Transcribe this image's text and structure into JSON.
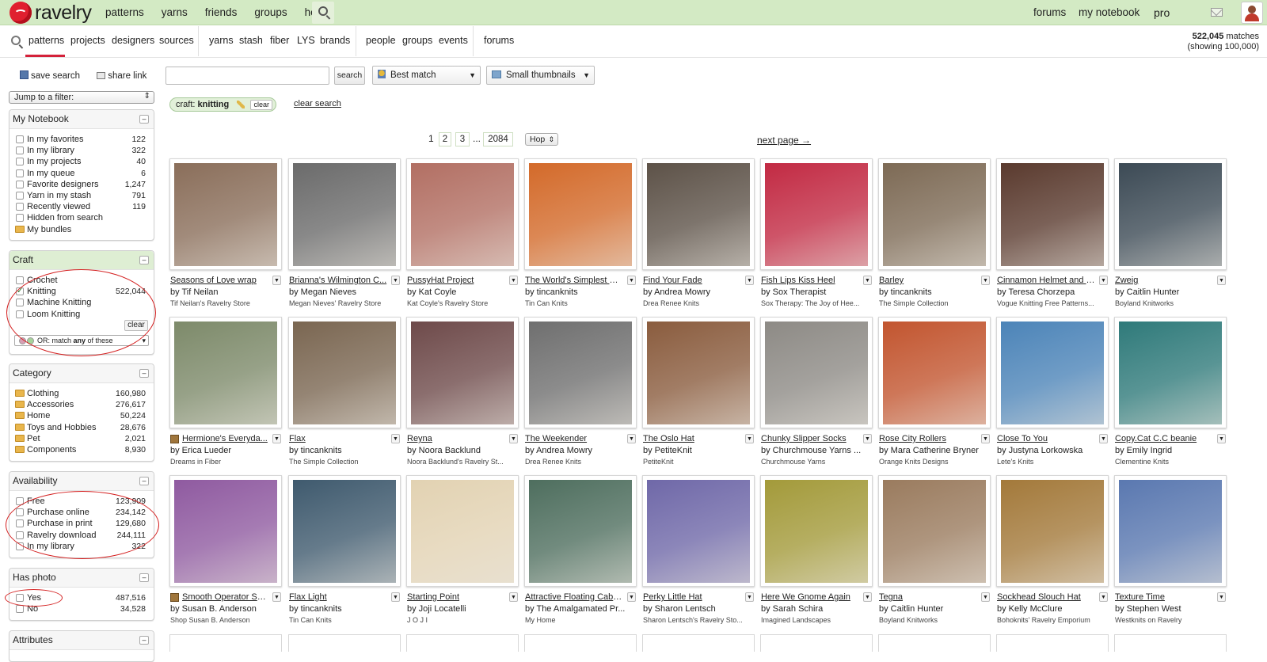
{
  "topbar": {
    "brand": "ravelry",
    "nav": [
      "patterns",
      "yarns",
      "friends",
      "groups",
      "help"
    ],
    "right": {
      "forums": "forums",
      "notebook": "my notebook",
      "pro": "pro"
    }
  },
  "subnav": {
    "group1": [
      "patterns",
      "projects",
      "designers",
      "sources"
    ],
    "group2": [
      "yarns",
      "stash",
      "fiber",
      "LYS",
      "brands"
    ],
    "group3": [
      "people",
      "groups",
      "events"
    ],
    "group4": [
      "forums"
    ],
    "matches_count": "522,045",
    "matches_label": "matches",
    "showing": "(showing 100,000)"
  },
  "sidebar": {
    "save_search": "save search",
    "share_link": "share link",
    "jump": "Jump to a filter:",
    "notebook": {
      "title": "My Notebook",
      "items": [
        {
          "label": "In my favorites",
          "count": "122"
        },
        {
          "label": "In my library",
          "count": "322"
        },
        {
          "label": "In my projects",
          "count": "40"
        },
        {
          "label": "In my queue",
          "count": "6"
        },
        {
          "label": "Favorite designers",
          "count": "1,247"
        },
        {
          "label": "Yarn in my stash",
          "count": "791"
        },
        {
          "label": "Recently viewed",
          "count": "119"
        },
        {
          "label": "Hidden from search",
          "count": ""
        },
        {
          "label": "My bundles",
          "count": ""
        }
      ]
    },
    "craft": {
      "title": "Craft",
      "items": [
        {
          "label": "Crochet",
          "count": "",
          "checked": false
        },
        {
          "label": "Knitting",
          "count": "522,044",
          "checked": true
        },
        {
          "label": "Machine Knitting",
          "count": "",
          "checked": false
        },
        {
          "label": "Loom Knitting",
          "count": "",
          "checked": false
        }
      ],
      "clear": "clear",
      "or_prefix": "OR: match ",
      "or_bold": "any",
      "or_suffix": " of these"
    },
    "category": {
      "title": "Category",
      "items": [
        {
          "label": "Clothing",
          "count": "160,980"
        },
        {
          "label": "Accessories",
          "count": "276,617"
        },
        {
          "label": "Home",
          "count": "50,224"
        },
        {
          "label": "Toys and Hobbies",
          "count": "28,676"
        },
        {
          "label": "Pet",
          "count": "2,021"
        },
        {
          "label": "Components",
          "count": "8,930"
        }
      ]
    },
    "availability": {
      "title": "Availability",
      "items": [
        {
          "label": "Free",
          "count": "123,909"
        },
        {
          "label": "Purchase online",
          "count": "234,142"
        },
        {
          "label": "Purchase in print",
          "count": "129,680"
        },
        {
          "label": "Ravelry download",
          "count": "244,111"
        },
        {
          "label": "In my library",
          "count": "322"
        }
      ]
    },
    "photo": {
      "title": "Has photo",
      "items": [
        {
          "label": "Yes",
          "count": "487,516"
        },
        {
          "label": "No",
          "count": "34,528"
        }
      ]
    },
    "attributes": {
      "title": "Attributes"
    }
  },
  "search": {
    "value": "",
    "button": "search",
    "sort": "Best match",
    "view": "Small thumbnails",
    "chip_key": "craft:",
    "chip_value": "knitting",
    "chip_clear": "clear",
    "clear_search": "clear search"
  },
  "pagination": {
    "current": "1",
    "pages": [
      "2",
      "3"
    ],
    "ellipsis": "...",
    "last": "2084",
    "hop": "Hop",
    "next": "next page →"
  },
  "patterns": [
    {
      "title": "Seasons of Love wrap",
      "by": "by Tif Neilan",
      "source": "Tif Neilan's Ravelry Store",
      "library": false,
      "color": "#8a6e5a"
    },
    {
      "title": "Brianna's Wilmington C...",
      "by": "by Megan Nieves",
      "source": "Megan Nieves' Ravelry Store",
      "library": false,
      "color": "#6b6b6b"
    },
    {
      "title": "PussyHat Project",
      "by": "by Kat Coyle",
      "source": "Kat Coyle's Ravelry Store",
      "library": false,
      "color": "#b26f63"
    },
    {
      "title": "The World's Simplest Mi...",
      "by": "by tincanknits",
      "source": "Tin Can Knits",
      "library": false,
      "color": "#d36a2a"
    },
    {
      "title": "Find Your Fade",
      "by": "by Andrea Mowry",
      "source": "Drea Renee Knits",
      "library": false,
      "color": "#5d5248"
    },
    {
      "title": "Fish Lips Kiss Heel",
      "by": "by Sox Therapist",
      "source": "Sox Therapy: The Joy of Hee...",
      "library": false,
      "color": "#c22a43"
    },
    {
      "title": "Barley",
      "by": "by tincanknits",
      "source": "The Simple Collection",
      "library": false,
      "color": "#7d6a55"
    },
    {
      "title": "Cinnamon Helmet and S...",
      "by": "by Teresa Chorzepa",
      "source": "Vogue Knitting Free Patterns...",
      "library": false,
      "color": "#5a3a2e"
    },
    {
      "title": "Zweig",
      "by": "by Caitlin Hunter",
      "source": "Boyland Knitworks",
      "library": false,
      "color": "#3c4a55"
    },
    {
      "title": "Hermione's Everyda...",
      "by": "by Erica Lueder",
      "source": "Dreams in Fiber",
      "library": true,
      "color": "#7d8a6a"
    },
    {
      "title": "Flax",
      "by": "by tincanknits",
      "source": "The Simple Collection",
      "library": false,
      "color": "#7a6651"
    },
    {
      "title": "Reyna",
      "by": "by Noora Backlund",
      "source": "Noora Backlund's Ravelry St...",
      "library": false,
      "color": "#6e4a4a"
    },
    {
      "title": "The Weekender",
      "by": "by Andrea Mowry",
      "source": "Drea Renee Knits",
      "library": false,
      "color": "#6f6f6f"
    },
    {
      "title": "The Oslo Hat",
      "by": "by PetiteKnit",
      "source": "PetiteKnit",
      "library": false,
      "color": "#8a5c3e"
    },
    {
      "title": "Chunky Slipper Socks",
      "by": "by Churchmouse Yarns ...",
      "source": "Churchmouse Yarns",
      "library": false,
      "color": "#8d8a85"
    },
    {
      "title": "Rose City Rollers",
      "by": "by Mara Catherine Bryner",
      "source": "Orange Knits Designs",
      "library": false,
      "color": "#c2552f"
    },
    {
      "title": "Close To You",
      "by": "by Justyna Lorkowska",
      "source": "Lete's Knits",
      "library": false,
      "color": "#4c84b8"
    },
    {
      "title": "Copy.Cat C.C beanie",
      "by": "by Emily Ingrid",
      "source": "Clementine Knits",
      "library": false,
      "color": "#2f7a7a"
    },
    {
      "title": "Smooth Operator So...",
      "by": "by Susan B. Anderson",
      "source": "Shop Susan B. Anderson",
      "library": true,
      "color": "#8f5aa0"
    },
    {
      "title": "Flax Light",
      "by": "by tincanknits",
      "source": "Tin Can Knits",
      "library": false,
      "color": "#3f5a6e"
    },
    {
      "title": "Starting Point",
      "by": "by Joji Locatelli",
      "source": "J O J I",
      "library": false,
      "color": "#e2d2b2"
    },
    {
      "title": "Attractive Floating Cables",
      "by": "by The Amalgamated Pr...",
      "source": "My Home",
      "library": false,
      "color": "#4e6e5e"
    },
    {
      "title": "Perky Little Hat",
      "by": "by Sharon Lentsch",
      "source": "Sharon Lentsch's Ravelry Sto...",
      "library": false,
      "color": "#6f68a8"
    },
    {
      "title": "Here We Gnome Again",
      "by": "by Sarah Schira",
      "source": "Imagined Landscapes",
      "library": false,
      "color": "#a39a3a"
    },
    {
      "title": "Tegna",
      "by": "by Caitlin Hunter",
      "source": "Boyland Knitworks",
      "library": false,
      "color": "#9a7b5e"
    },
    {
      "title": "Sockhead Slouch Hat",
      "by": "by Kelly McClure",
      "source": "Bohoknits' Ravelry Emporium",
      "library": false,
      "color": "#a3793a"
    },
    {
      "title": "Texture Time",
      "by": "by Stephen West",
      "source": "Westknits on Ravelry",
      "library": false,
      "color": "#5a78b0"
    }
  ]
}
